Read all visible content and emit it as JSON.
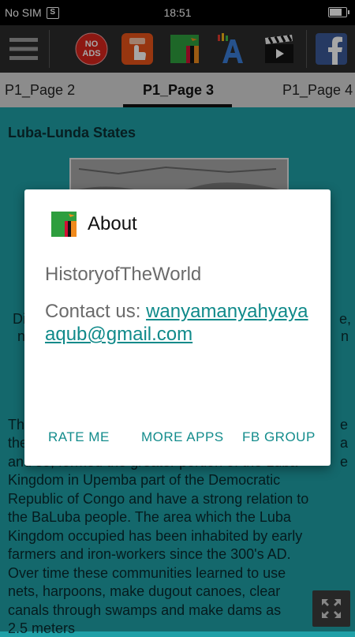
{
  "status_bar": {
    "carrier": "No SIM",
    "sim_badge": "S",
    "time": "18:51",
    "battery_level": 0.75
  },
  "toolbar": {
    "menu_icon": "hamburger-menu-icon",
    "no_ads_label_line1": "NO",
    "no_ads_label_line2": "ADS",
    "colors": {
      "background": "#2b2b2b",
      "red": "#d9261c",
      "orange": "#e8531a",
      "green": "#2e9e3e",
      "facebook": "#3b5998"
    }
  },
  "tabs": {
    "items": [
      "P1_Page 2",
      "P1_Page 3",
      "P1_Page 4"
    ],
    "active": "P1_Page 3"
  },
  "content": {
    "heading": "Luba-Lunda States",
    "frag_left1": "Di",
    "frag_left2": "n",
    "frag_right1": "e,",
    "frag_right2": "n",
    "body": "The Luba-Lunda States or the Luba Empire was a Central African state that arose in the Upemba Depression in what is now the southern Democratic Republic of the Congo. Th the and so, formed the greater portion of the Luba Kingdom in Upemba part of the Democratic Republic of Congo and have a strong relation to the BaLuba people. The area which the Luba Kingdom occupied has been inhabited by early farmers and iron-workers since the 300's AD. Over time these communities learned to use nets, harpoons, make dugout canoes, clear canals through swamps and make dams as",
    "body_lines": [
      "Th",
      "the",
      "and so, formed the greater portion of the Luba",
      "Kingdom in Upemba part of the Democratic",
      "Republic of Congo and have a strong relation to",
      "the BaLuba people. The area which the Luba",
      "Kingdom occupied has been inhabited by early",
      "farmers and iron-workers since the 300's AD.",
      "Over time these communities learned to use",
      "nets, harpoons, make dugout canoes, clear",
      "canals through swamps and make dams as",
      "2.5 meters"
    ],
    "right_frags": [
      "e",
      "a",
      "e"
    ]
  },
  "dialog": {
    "title": "About",
    "app_name": "HistoryofTheWorld",
    "contact_label": "Contact us: ",
    "contact_email": "wanyamanyahyayaaqub@gmail.com",
    "actions": {
      "rate": "RATE ME",
      "more": "MORE APPS",
      "fb": "FB GROUP"
    },
    "accent_color": "#138c8c"
  }
}
